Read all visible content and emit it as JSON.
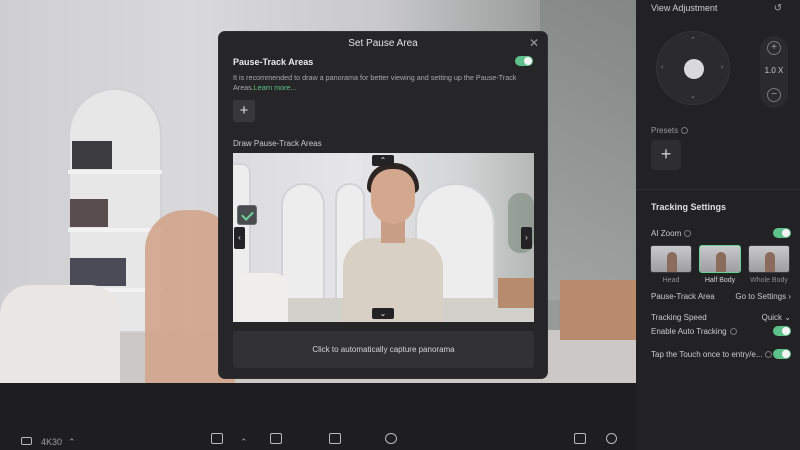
{
  "modal": {
    "title": "Set Pause Area",
    "close_icon": "close-icon",
    "pause_track_label": "Pause-Track Areas",
    "pause_track_enabled": true,
    "description": "It is recommended to draw a panorama for better viewing and setting up the Pause-Track Areas.",
    "learn_more": "Learn more...",
    "add_icon": "plus-icon",
    "draw_label": "Draw Pause-Track Areas",
    "capture_label": "Click to automatically capture panorama"
  },
  "sidebar": {
    "view_adjustment": "View Adjustment",
    "zoom_value": "1.0 X",
    "presets_label": "Presets",
    "tracking_settings": "Tracking Settings",
    "ai_zoom_label": "AI Zoom",
    "ai_zoom_enabled": true,
    "framing": [
      {
        "label": "Head",
        "active": false
      },
      {
        "label": "Half Body",
        "active": true
      },
      {
        "label": "Whole Body",
        "active": false
      }
    ],
    "pause_track_area_label": "Pause-Track Area",
    "go_to_settings": "Go to Settings",
    "tracking_speed_label": "Tracking Speed",
    "tracking_speed_value": "Quick",
    "auto_tracking_label": "Enable Auto Tracking",
    "auto_tracking_enabled": true,
    "tap_touch_label": "Tap the Touch once to entry/e...",
    "tap_touch_enabled": true
  },
  "bottombar": {
    "resolution": "4K30"
  },
  "colors": {
    "accent": "#5ec08a",
    "panel": "#262628",
    "sidebar": "#222224"
  }
}
